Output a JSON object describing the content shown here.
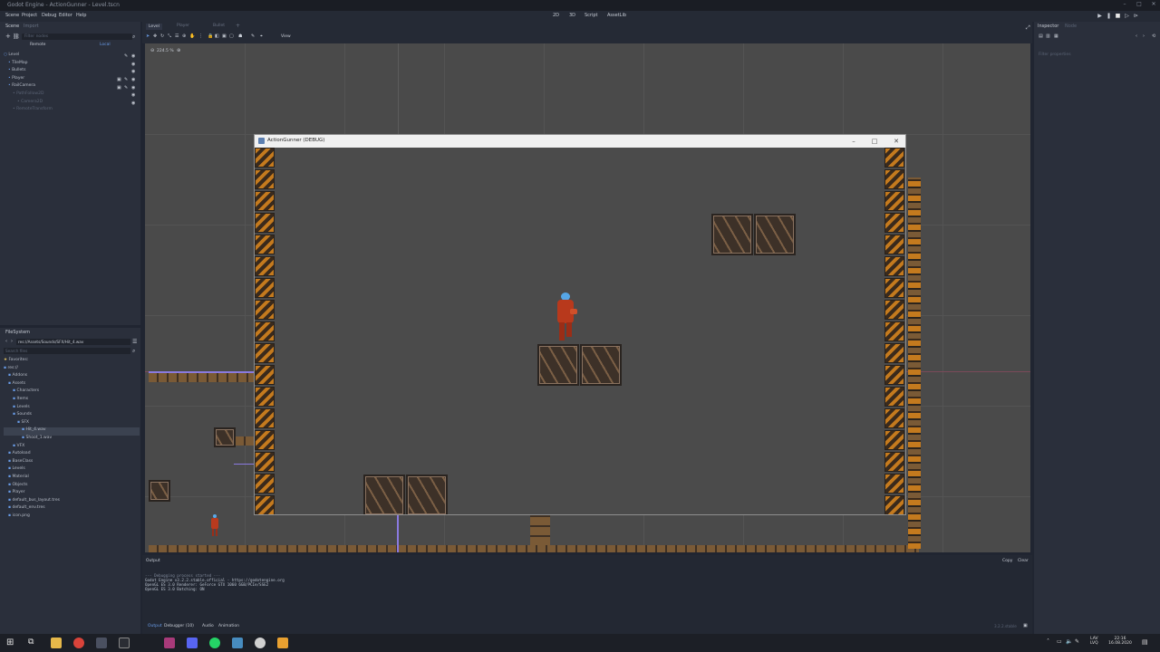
{
  "window": {
    "title": "Godot Engine - ActionGunner - Level.tscn"
  },
  "menu": [
    "Scene",
    "Project",
    "Debug",
    "Editor",
    "Help"
  ],
  "workspaces": [
    "2D",
    "3D",
    "Script",
    "AssetLib"
  ],
  "scene_dock": {
    "tabs": [
      "Scene",
      "Import"
    ],
    "filter_placeholder": "Filter nodes",
    "remote_label": "Remote",
    "local_label": "Local",
    "nodes": [
      {
        "label": "Level",
        "indent": 0
      },
      {
        "label": "TileMap",
        "indent": 1
      },
      {
        "label": "Bullets",
        "indent": 1
      },
      {
        "label": "Player",
        "indent": 1
      },
      {
        "label": "RailCamera",
        "indent": 1
      },
      {
        "label": "PathFollow2D",
        "indent": 2,
        "dim": true
      },
      {
        "label": "Camera2D",
        "indent": 3,
        "dim": true
      },
      {
        "label": "RemoteTransform",
        "indent": 2,
        "dim": true
      }
    ]
  },
  "filesystem": {
    "title": "FileSystem",
    "path": "res://Assets/Sounds/SFX/Hit_4.wav",
    "search_placeholder": "Search files",
    "items": [
      {
        "label": "Favorites:",
        "indent": 0
      },
      {
        "label": "res://",
        "indent": 0
      },
      {
        "label": "Addons",
        "indent": 1
      },
      {
        "label": "Assets",
        "indent": 1
      },
      {
        "label": "Characters",
        "indent": 2
      },
      {
        "label": "Items",
        "indent": 2
      },
      {
        "label": "Levels",
        "indent": 2
      },
      {
        "label": "Sounds",
        "indent": 2
      },
      {
        "label": "SFX",
        "indent": 3
      },
      {
        "label": "Hit_4.wav",
        "indent": 4,
        "selected": true
      },
      {
        "label": "Shoot_1.wav",
        "indent": 4
      },
      {
        "label": "VFX",
        "indent": 2
      },
      {
        "label": "Autoload",
        "indent": 1
      },
      {
        "label": "BaseClass",
        "indent": 1
      },
      {
        "label": "Levels",
        "indent": 1
      },
      {
        "label": "Material",
        "indent": 1
      },
      {
        "label": "Objects",
        "indent": 1
      },
      {
        "label": "Player",
        "indent": 1
      },
      {
        "label": "default_bus_layout.tres",
        "indent": 1
      },
      {
        "label": "default_env.tres",
        "indent": 1
      },
      {
        "label": "icon.png",
        "indent": 1
      }
    ]
  },
  "editor_tabs": [
    "Level",
    "Player",
    "Bullet"
  ],
  "toolbar": {
    "view_label": "View"
  },
  "zoom": "224.5 %",
  "inspector": {
    "tab": "Inspector",
    "tab2": "Node",
    "empty_label": "Filter properties"
  },
  "game_window": {
    "title": "ActionGunner (DEBUG)"
  },
  "output": {
    "title": "Output",
    "copy_label": "Copy",
    "clear_label": "Clear",
    "lines": [
      "--- Debugging process started ---",
      "Godot Engine v3.2.2.stable.official - https://godotengine.org",
      "OpenGL ES 3.0 Renderer: GeForce GTX 1060 6GB/PCIe/SSE2",
      "OpenGL ES 3.0 Batching: ON"
    ]
  },
  "bottom_tabs": [
    "Output",
    "Debugger (10)",
    "Audio",
    "Animation"
  ],
  "version": "3.2.2.stable",
  "tray": {
    "lang1": "LAV",
    "lang2": "LVQ",
    "time": "22:16",
    "date": "16.08.2020"
  },
  "colors": {
    "accent": "#699ce8",
    "editor_bg": "#202531",
    "viewport_bg": "#4a4a4a",
    "brick": "#c47a1e"
  }
}
